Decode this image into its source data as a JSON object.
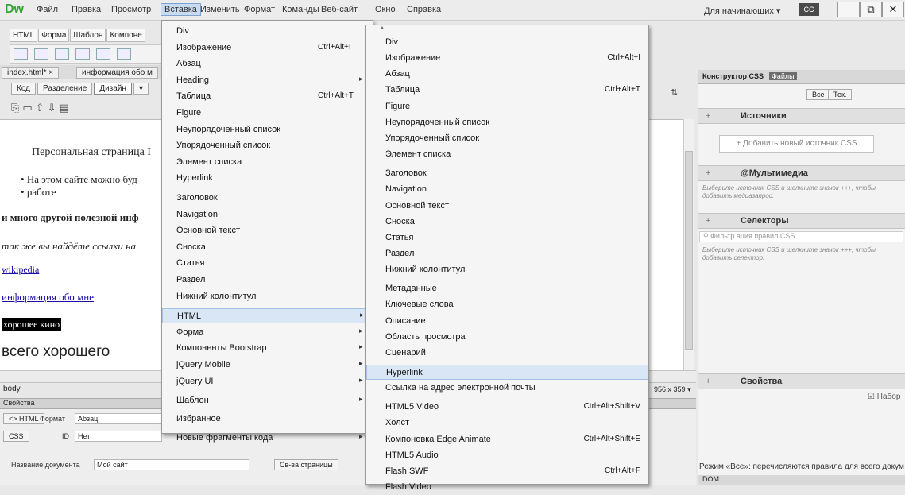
{
  "app": {
    "logo": "Dw",
    "menubar": [
      "Файл",
      "Правка",
      "Просмотр",
      "Вставка",
      "Изменить",
      "Формат",
      "Команды",
      "Веб-сайт",
      "Окно",
      "Справка"
    ],
    "workspace": "Для начинающих",
    "workspace_arrow": "▾",
    "cc_label": "CC",
    "win_min": "–",
    "win_max": "⧉",
    "win_close": "✕"
  },
  "insert_panel": {
    "tabs": [
      "HTML",
      "Форма",
      "Шаблон",
      "Компоне"
    ]
  },
  "doc": {
    "tabs": [
      "index.html*",
      "информация обо м"
    ],
    "tab_close": "×",
    "views": [
      "Код",
      "Разделение",
      "Дизайн"
    ],
    "view_arrow": "▾",
    "heading": "Персональная страница I",
    "bullets": [
      "На этом сайте можно буд",
      "работе"
    ],
    "bold_line": "и много другой полезной инф",
    "italic_line": "так же вы найдёте ссылки на",
    "link1": "wikipedia",
    "link2": "информация обо мне",
    "highlight": "хорошее кино",
    "big_text": "всего хорошего",
    "status_tag": "body",
    "size_readout": "956 x 359",
    "size_arrow": "▾",
    "sort_icon_label": "⇅"
  },
  "properties": {
    "title": "Свойства",
    "html_btn": "<> HTML",
    "css_btn": "CSS",
    "format_label": "Формат",
    "format_value": "Абзац",
    "id_label": "ID",
    "id_value": "Нет",
    "doc_title_label": "Название документа",
    "doc_title_value": "Мой сайт",
    "page_props_btn": "Св-ва страницы"
  },
  "right_panel": {
    "tabs": [
      "Конструктор CSS",
      "Файлы"
    ],
    "filter_all": "Все",
    "filter_current": "Тек.",
    "sources_title": "Источники",
    "add_source": "+ Добавить новый источник CSS",
    "media_title": "@Мультимедиа",
    "media_hint": "Выберите источник CSS и щелкните значок +++, чтобы добавить медиазапрос.",
    "selectors_title": "Селекторы",
    "selectors_filter_placeholder": "Фильтр ация правил CSS",
    "selectors_hint": "Выберите источник CSS и щелкните значок +++, чтобы добавить селектор.",
    "properties_title": "Свойства",
    "set_checkbox": "Набор",
    "footer_text": "Режим «Все»: перечисляются правила для всего докум",
    "dom_tab": "DOM",
    "add_sym": "+",
    "sep_sym": "—"
  },
  "insert_menu": {
    "items": [
      {
        "label": "Div",
        "shortcut": "",
        "sub": false
      },
      {
        "label": "Изображение",
        "shortcut": "Ctrl+Alt+I",
        "sub": false
      },
      {
        "label": "Абзац",
        "shortcut": "",
        "sub": false
      },
      {
        "label": "Heading",
        "shortcut": "",
        "sub": true
      },
      {
        "label": "Таблица",
        "shortcut": "Ctrl+Alt+T",
        "sub": false
      },
      {
        "label": "Figure",
        "shortcut": "",
        "sub": false
      },
      {
        "label": "Неупорядоченный список",
        "shortcut": "",
        "sub": false
      },
      {
        "label": "Упорядоченный список",
        "shortcut": "",
        "sub": false
      },
      {
        "label": "Элемент списка",
        "shortcut": "",
        "sub": false
      },
      {
        "label": "Hyperlink",
        "shortcut": "",
        "sub": false
      },
      {
        "label": "Заголовок",
        "shortcut": "",
        "sub": false
      },
      {
        "label": "Navigation",
        "shortcut": "",
        "sub": false
      },
      {
        "label": "Основной текст",
        "shortcut": "",
        "sub": false
      },
      {
        "label": "Сноска",
        "shortcut": "",
        "sub": false
      },
      {
        "label": "Статья",
        "shortcut": "",
        "sub": false
      },
      {
        "label": "Раздел",
        "shortcut": "",
        "sub": false
      },
      {
        "label": "Нижний колонтитул",
        "shortcut": "",
        "sub": false
      },
      {
        "label": "HTML",
        "shortcut": "",
        "sub": true
      },
      {
        "label": "Форма",
        "shortcut": "",
        "sub": true
      },
      {
        "label": "Компоненты Bootstrap",
        "shortcut": "",
        "sub": true
      },
      {
        "label": "jQuery Mobile",
        "shortcut": "",
        "sub": true
      },
      {
        "label": "jQuery UI",
        "shortcut": "",
        "sub": true
      },
      {
        "label": "Шаблон",
        "shortcut": "",
        "sub": true
      },
      {
        "label": "Избранное",
        "shortcut": "",
        "sub": false
      },
      {
        "label": "Новые фрагменты кода",
        "shortcut": "",
        "sub": true
      }
    ]
  },
  "html_submenu": {
    "items": [
      {
        "label": "Div",
        "shortcut": ""
      },
      {
        "label": "Изображение",
        "shortcut": "Ctrl+Alt+I"
      },
      {
        "label": "Абзац",
        "shortcut": ""
      },
      {
        "label": "Таблица",
        "shortcut": "Ctrl+Alt+T"
      },
      {
        "label": "Figure",
        "shortcut": ""
      },
      {
        "label": "Неупорядоченный список",
        "shortcut": ""
      },
      {
        "label": "Упорядоченный список",
        "shortcut": ""
      },
      {
        "label": "Элемент списка",
        "shortcut": ""
      },
      {
        "label": "Заголовок",
        "shortcut": ""
      },
      {
        "label": "Navigation",
        "shortcut": ""
      },
      {
        "label": "Основной текст",
        "shortcut": ""
      },
      {
        "label": "Сноска",
        "shortcut": ""
      },
      {
        "label": "Статья",
        "shortcut": ""
      },
      {
        "label": "Раздел",
        "shortcut": ""
      },
      {
        "label": "Нижний колонтитул",
        "shortcut": ""
      },
      {
        "label": "Метаданные",
        "shortcut": ""
      },
      {
        "label": "Ключевые слова",
        "shortcut": ""
      },
      {
        "label": "Описание",
        "shortcut": ""
      },
      {
        "label": "Область просмотра",
        "shortcut": ""
      },
      {
        "label": "Сценарий",
        "shortcut": ""
      },
      {
        "label": "Hyperlink",
        "shortcut": ""
      },
      {
        "label": "Ссылка на адрес электронной почты",
        "shortcut": ""
      },
      {
        "label": "HTML5 Video",
        "shortcut": "Ctrl+Alt+Shift+V"
      },
      {
        "label": "Холст",
        "shortcut": ""
      },
      {
        "label": "Компоновка Edge Animate",
        "shortcut": "Ctrl+Alt+Shift+E"
      },
      {
        "label": "HTML5 Audio",
        "shortcut": ""
      },
      {
        "label": "Flash SWF",
        "shortcut": "Ctrl+Alt+F"
      },
      {
        "label": "Flash Video",
        "shortcut": ""
      }
    ]
  },
  "colors": {
    "menu_highlight": "#d9e6f5",
    "link": "#1a0dab",
    "logo_green": "#35a235"
  }
}
